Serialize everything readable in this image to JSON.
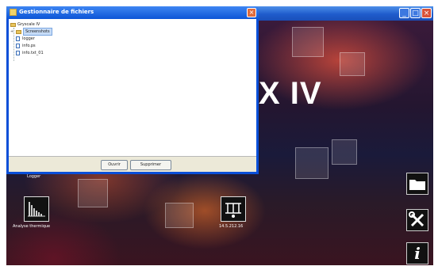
{
  "app_window": {
    "brand_partial_text": "X IV",
    "window_controls": {
      "minimize": "_",
      "maximize": "□",
      "close": "×"
    }
  },
  "dialog": {
    "title": "Gestionnaire de fichiers",
    "close_glyph": "×",
    "tree": {
      "root_label": "Gryscale IV",
      "selected_folder_label": "Screenshots",
      "files": [
        "logger",
        "info.ps",
        "info.txt_01"
      ]
    },
    "buttons": {
      "open": "Ouvrir",
      "delete": "Supprimer"
    }
  },
  "desktop_icons": [
    {
      "label": "Logger"
    },
    {
      "label": "Analyse thermique"
    },
    {
      "label": "14.5.212.16"
    }
  ],
  "side_buttons": {
    "info_glyph": "i"
  }
}
